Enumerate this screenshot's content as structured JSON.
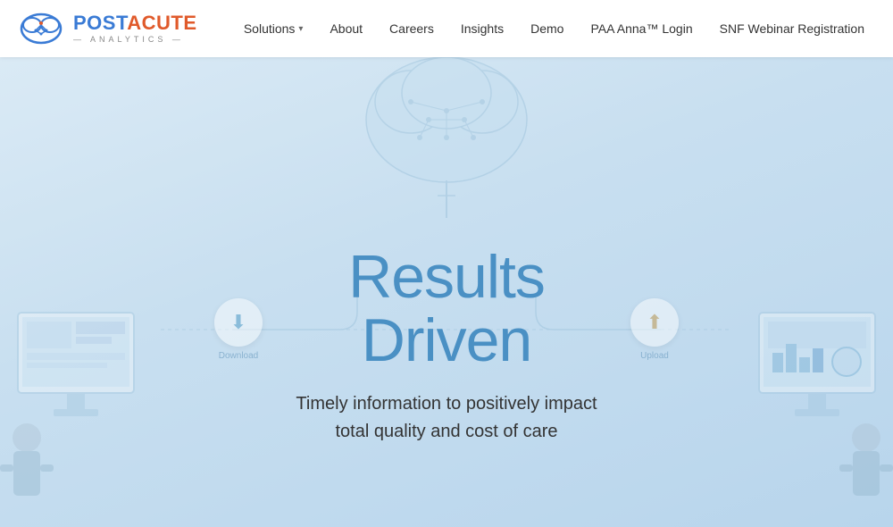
{
  "header": {
    "logo": {
      "part1": "POST",
      "part2": "ACUTE",
      "sub": "— ANALYTICS —"
    },
    "nav": {
      "items": [
        {
          "id": "solutions",
          "label": "Solutions",
          "hasDropdown": true
        },
        {
          "id": "about",
          "label": "About",
          "hasDropdown": false
        },
        {
          "id": "careers",
          "label": "Careers",
          "hasDropdown": false
        },
        {
          "id": "insights",
          "label": "Insights",
          "hasDropdown": false
        },
        {
          "id": "demo",
          "label": "Demo",
          "hasDropdown": false
        },
        {
          "id": "paa-anna-login",
          "label": "PAA Anna™ Login",
          "hasDropdown": false
        },
        {
          "id": "snf-webinar",
          "label": "SNF Webinar Registration",
          "hasDropdown": false
        }
      ]
    }
  },
  "hero": {
    "title_line1": "Results",
    "title_line2": "Driven",
    "subtitle": "Timely information to positively impact total quality and cost of care",
    "node_left_label": "Download",
    "node_right_label": "Upload"
  }
}
